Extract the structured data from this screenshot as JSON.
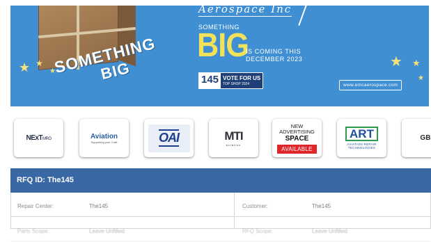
{
  "banner": {
    "left_line1": "SOMETHING",
    "left_line2": "BIG",
    "script_title": "Aerospace Inc",
    "small_word": "SOMETHING",
    "big_word": "BIG",
    "coming_line1": "IS COMING THIS",
    "coming_line2": "DECEMBER 2023",
    "badge_number": "145",
    "badge_vote": "VOTE FOR US",
    "badge_vote_sub": "TOP SHOP 2024",
    "url": "www.emcaerospace.com"
  },
  "logos": {
    "nextmro": "NExT",
    "nextmro_sub": "MRO",
    "aviation": "Aviation",
    "aviation_tag": "Supporting your Craft",
    "oai": "OAI",
    "mti": "MTI",
    "mti_sub": "aviation",
    "advert_line1": "NEW",
    "advert_line2": "ADVERTISING",
    "advert_line3": "SPACE",
    "advert_available": "AVAILABLE",
    "art": "ART",
    "art_sub1": "AVIATION REPAIR",
    "art_sub2": "TECHNOLOGIES",
    "gbpa": "GBPA"
  },
  "rfq": {
    "header": "RFQ ID: The145",
    "rows": [
      {
        "left_label": "Repair Center:",
        "left_value": "The145",
        "right_label": "Customer:",
        "right_value": "The145"
      },
      {
        "left_label": "Parts Scope:",
        "left_value": "Leave Unfilled",
        "right_label": "RFQ Scope:",
        "right_value": "Leave Unfilled"
      }
    ]
  }
}
